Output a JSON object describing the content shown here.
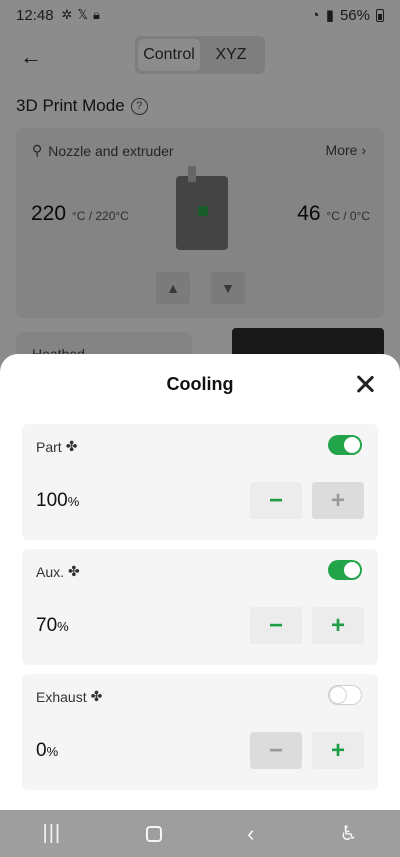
{
  "status_bar": {
    "time": "12:48",
    "left_icons": [
      "fan-icon",
      "x-icon",
      "lock-icon"
    ],
    "battery": "56%"
  },
  "topbar": {
    "tabs": [
      {
        "label": "Control",
        "active": true
      },
      {
        "label": "XYZ",
        "active": false
      }
    ]
  },
  "page": {
    "title": "3D Print Mode",
    "help_icon": "?"
  },
  "nozzle": {
    "label": "Nozzle and extruder",
    "more": "More",
    "left_temp": {
      "value": "220",
      "unit": "°C / 220°C"
    },
    "right_temp": {
      "value": "46",
      "unit": "°C / 0°C"
    }
  },
  "heatbed": {
    "label": "Heatbed"
  },
  "sheet": {
    "title": "Cooling",
    "fans": [
      {
        "label": "Part",
        "value": "100",
        "unit": "%",
        "enabled": true
      },
      {
        "label": "Aux.",
        "value": "70",
        "unit": "%",
        "enabled": true
      },
      {
        "label": "Exhaust",
        "value": "0",
        "unit": "%",
        "enabled": false
      }
    ],
    "minus_label": "−",
    "plus_label": "+"
  },
  "colors": {
    "accent": "#22a44a",
    "sheet_bg": "#ffffff",
    "card_bg": "#f5f5f5"
  }
}
